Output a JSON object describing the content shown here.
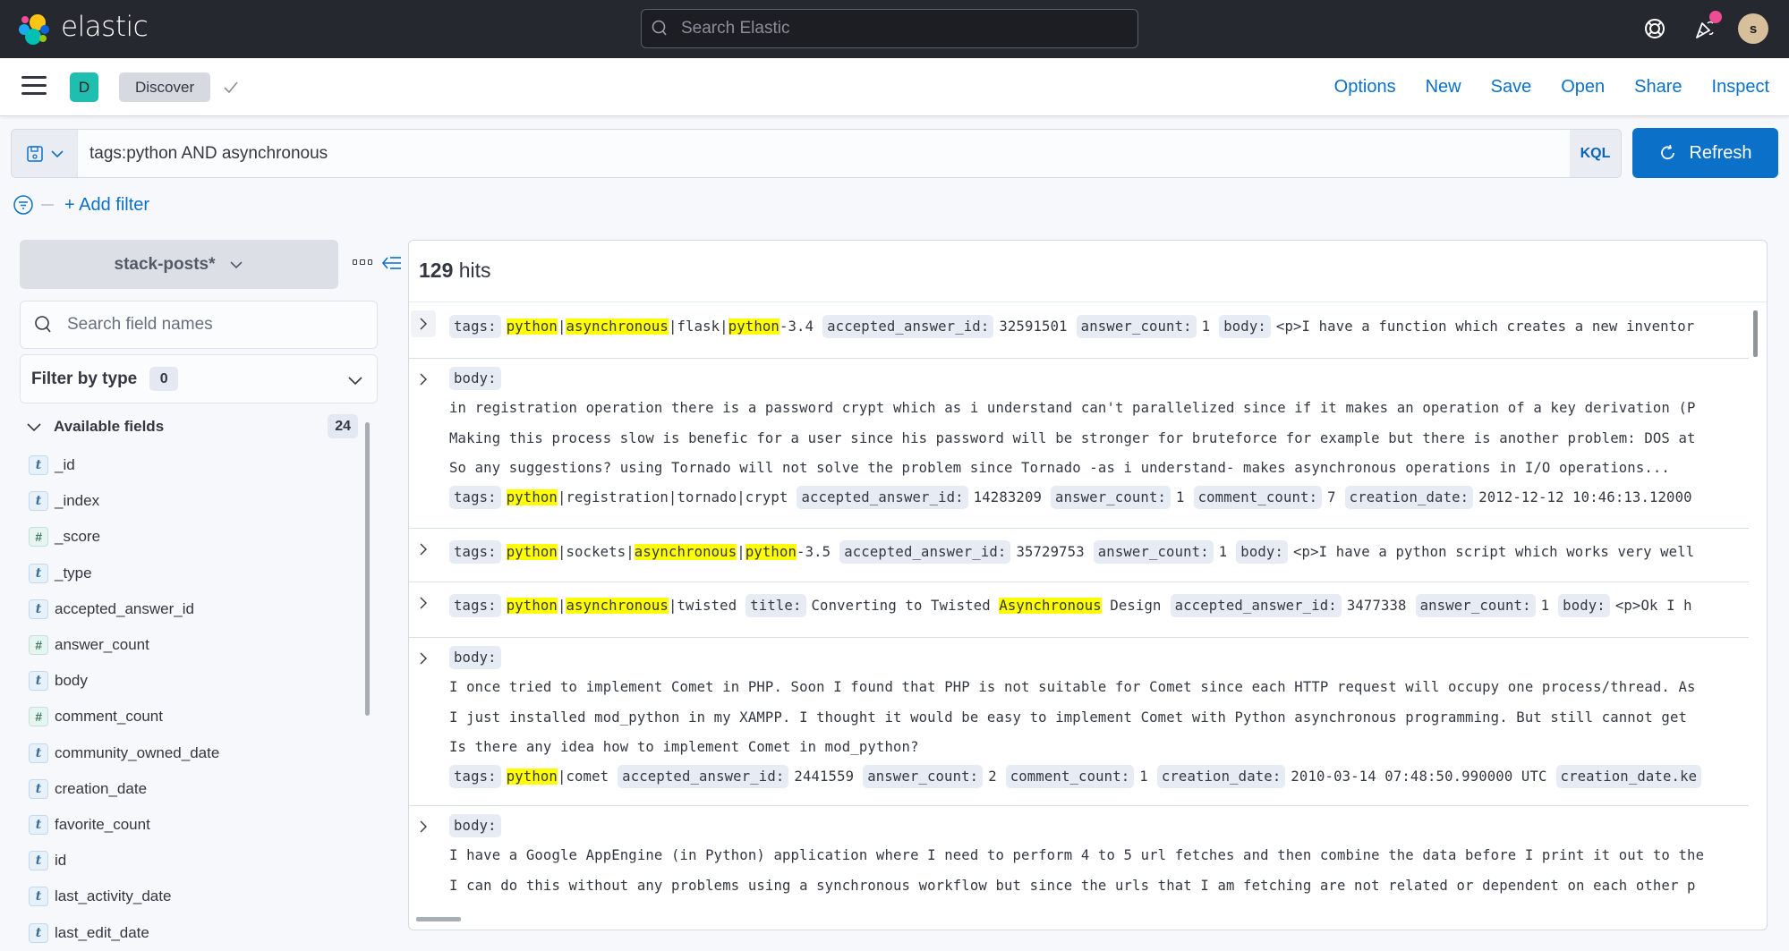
{
  "header": {
    "brand": "elastic",
    "search_placeholder": "Search Elastic",
    "avatar_initial": "s"
  },
  "nav": {
    "space_initial": "D",
    "breadcrumb": "Discover",
    "links": [
      "Options",
      "New",
      "Save",
      "Open",
      "Share",
      "Inspect"
    ]
  },
  "query": {
    "value": "tags:python AND asynchronous",
    "language": "KQL",
    "refresh_label": "Refresh",
    "add_filter_label": "+ Add filter"
  },
  "sidebar": {
    "index_pattern": "stack-posts*",
    "field_search_placeholder": "Search field names",
    "filter_by_type_label": "Filter by type",
    "filter_by_type_count": "0",
    "available_fields_label": "Available fields",
    "available_fields_count": "24",
    "fields": [
      {
        "name": "_id",
        "type": "t"
      },
      {
        "name": "_index",
        "type": "t"
      },
      {
        "name": "_score",
        "type": "#"
      },
      {
        "name": "_type",
        "type": "t"
      },
      {
        "name": "accepted_answer_id",
        "type": "t"
      },
      {
        "name": "answer_count",
        "type": "#"
      },
      {
        "name": "body",
        "type": "t"
      },
      {
        "name": "comment_count",
        "type": "#"
      },
      {
        "name": "community_owned_date",
        "type": "t"
      },
      {
        "name": "creation_date",
        "type": "t"
      },
      {
        "name": "favorite_count",
        "type": "t"
      },
      {
        "name": "id",
        "type": "t"
      },
      {
        "name": "last_activity_date",
        "type": "t"
      },
      {
        "name": "last_edit_date",
        "type": "t"
      }
    ]
  },
  "results": {
    "hits_count": "129",
    "hits_label": "hits",
    "documents": [
      {
        "lines": [
          [
            {
              "k": "tags:"
            },
            {
              "v": [
                [
                  "python",
                  true
                ],
                [
                  "|",
                  false
                ],
                [
                  "asynchronous",
                  true
                ],
                [
                  "|flask|",
                  false
                ],
                [
                  "python",
                  true
                ],
                [
                  "-3.4",
                  false
                ]
              ]
            },
            {
              "k": "accepted_answer_id:"
            },
            {
              "v": [
                [
                  "32591501",
                  false
                ]
              ]
            },
            {
              "k": "answer_count:"
            },
            {
              "v": [
                [
                  "1",
                  false
                ]
              ]
            },
            {
              "k": "body:"
            },
            {
              "v": [
                [
                  "<p>I have a function which creates a new inventor",
                  false
                ]
              ]
            }
          ]
        ]
      },
      {
        "lines": [
          [
            {
              "k": "body:"
            }
          ],
          [
            {
              "t": "in registration operation there is a password crypt which as i understand can't parallelized since if it makes an operation of a key derivation (P"
            }
          ],
          [
            {
              "t": "Making this process slow is benefic for a user since his password will be stronger for bruteforce for example but there is another problem: DOS at"
            }
          ],
          [
            {
              "t": "So any suggestions? using Tornado will not solve the problem since Tornado -as i understand- makes asynchronous operations in I/O operations..."
            }
          ],
          [
            {
              "k": "tags:"
            },
            {
              "v": [
                [
                  "python",
                  true
                ],
                [
                  "|registration|tornado|crypt",
                  false
                ]
              ]
            },
            {
              "k": "accepted_answer_id:"
            },
            {
              "v": [
                [
                  "14283209",
                  false
                ]
              ]
            },
            {
              "k": "answer_count:"
            },
            {
              "v": [
                [
                  "1",
                  false
                ]
              ]
            },
            {
              "k": "comment_count:"
            },
            {
              "v": [
                [
                  "7",
                  false
                ]
              ]
            },
            {
              "k": "creation_date:"
            },
            {
              "v": [
                [
                  "2012-12-12 10:46:13.12000",
                  false
                ]
              ]
            }
          ]
        ]
      },
      {
        "lines": [
          [
            {
              "k": "tags:"
            },
            {
              "v": [
                [
                  "python",
                  true
                ],
                [
                  "|sockets|",
                  false
                ],
                [
                  "asynchronous",
                  true
                ],
                [
                  "|",
                  false
                ],
                [
                  "python",
                  true
                ],
                [
                  "-3.5",
                  false
                ]
              ]
            },
            {
              "k": "accepted_answer_id:"
            },
            {
              "v": [
                [
                  "35729753",
                  false
                ]
              ]
            },
            {
              "k": "answer_count:"
            },
            {
              "v": [
                [
                  "1",
                  false
                ]
              ]
            },
            {
              "k": "body:"
            },
            {
              "v": [
                [
                  "<p>I have a python script which works very well",
                  false
                ]
              ]
            }
          ]
        ]
      },
      {
        "lines": [
          [
            {
              "k": "tags:"
            },
            {
              "v": [
                [
                  "python",
                  true
                ],
                [
                  "|",
                  false
                ],
                [
                  "asynchronous",
                  true
                ],
                [
                  "|twisted",
                  false
                ]
              ]
            },
            {
              "k": "title:"
            },
            {
              "v": [
                [
                  "Converting to Twisted ",
                  false
                ],
                [
                  "Asynchronous",
                  true
                ],
                [
                  " Design",
                  false
                ]
              ]
            },
            {
              "k": "accepted_answer_id:"
            },
            {
              "v": [
                [
                  "3477338",
                  false
                ]
              ]
            },
            {
              "k": "answer_count:"
            },
            {
              "v": [
                [
                  "1",
                  false
                ]
              ]
            },
            {
              "k": "body:"
            },
            {
              "v": [
                [
                  "<p>Ok I h",
                  false
                ]
              ]
            }
          ]
        ]
      },
      {
        "lines": [
          [
            {
              "k": "body:"
            }
          ],
          [
            {
              "t": "I once tried to implement Comet in PHP. Soon I found that PHP is not suitable for Comet since each HTTP request will occupy one process/thread. As"
            }
          ],
          [
            {
              "t": "I just installed mod_python in my XAMPP. I thought it would be easy to implement Comet with Python asynchronous programming. But still cannot get"
            }
          ],
          [
            {
              "t": "Is there any idea how to implement Comet in mod_python?"
            }
          ],
          [
            {
              "k": "tags:"
            },
            {
              "v": [
                [
                  "python",
                  true
                ],
                [
                  "|comet",
                  false
                ]
              ]
            },
            {
              "k": "accepted_answer_id:"
            },
            {
              "v": [
                [
                  "2441559",
                  false
                ]
              ]
            },
            {
              "k": "answer_count:"
            },
            {
              "v": [
                [
                  "2",
                  false
                ]
              ]
            },
            {
              "k": "comment_count:"
            },
            {
              "v": [
                [
                  "1",
                  false
                ]
              ]
            },
            {
              "k": "creation_date:"
            },
            {
              "v": [
                [
                  "2010-03-14 07:48:50.990000 UTC",
                  false
                ]
              ]
            },
            {
              "k": "creation_date.ke"
            }
          ]
        ]
      },
      {
        "lines": [
          [
            {
              "k": "body:"
            }
          ],
          [
            {
              "t": "I have a Google AppEngine (in Python) application where I need to perform 4 to 5 url fetches and then combine the data before I print it out to the"
            }
          ],
          [
            {
              "t": "I can do this without any problems using a synchronous workflow but since the urls that I am fetching are not related or dependent on each other p"
            }
          ]
        ]
      }
    ]
  },
  "colors": {
    "accent": "#0b71c8",
    "header_bg": "#25282f",
    "highlight": "#ffff00",
    "space_badge": "#1ebfb1",
    "notification_dot": "#ee4c94"
  }
}
